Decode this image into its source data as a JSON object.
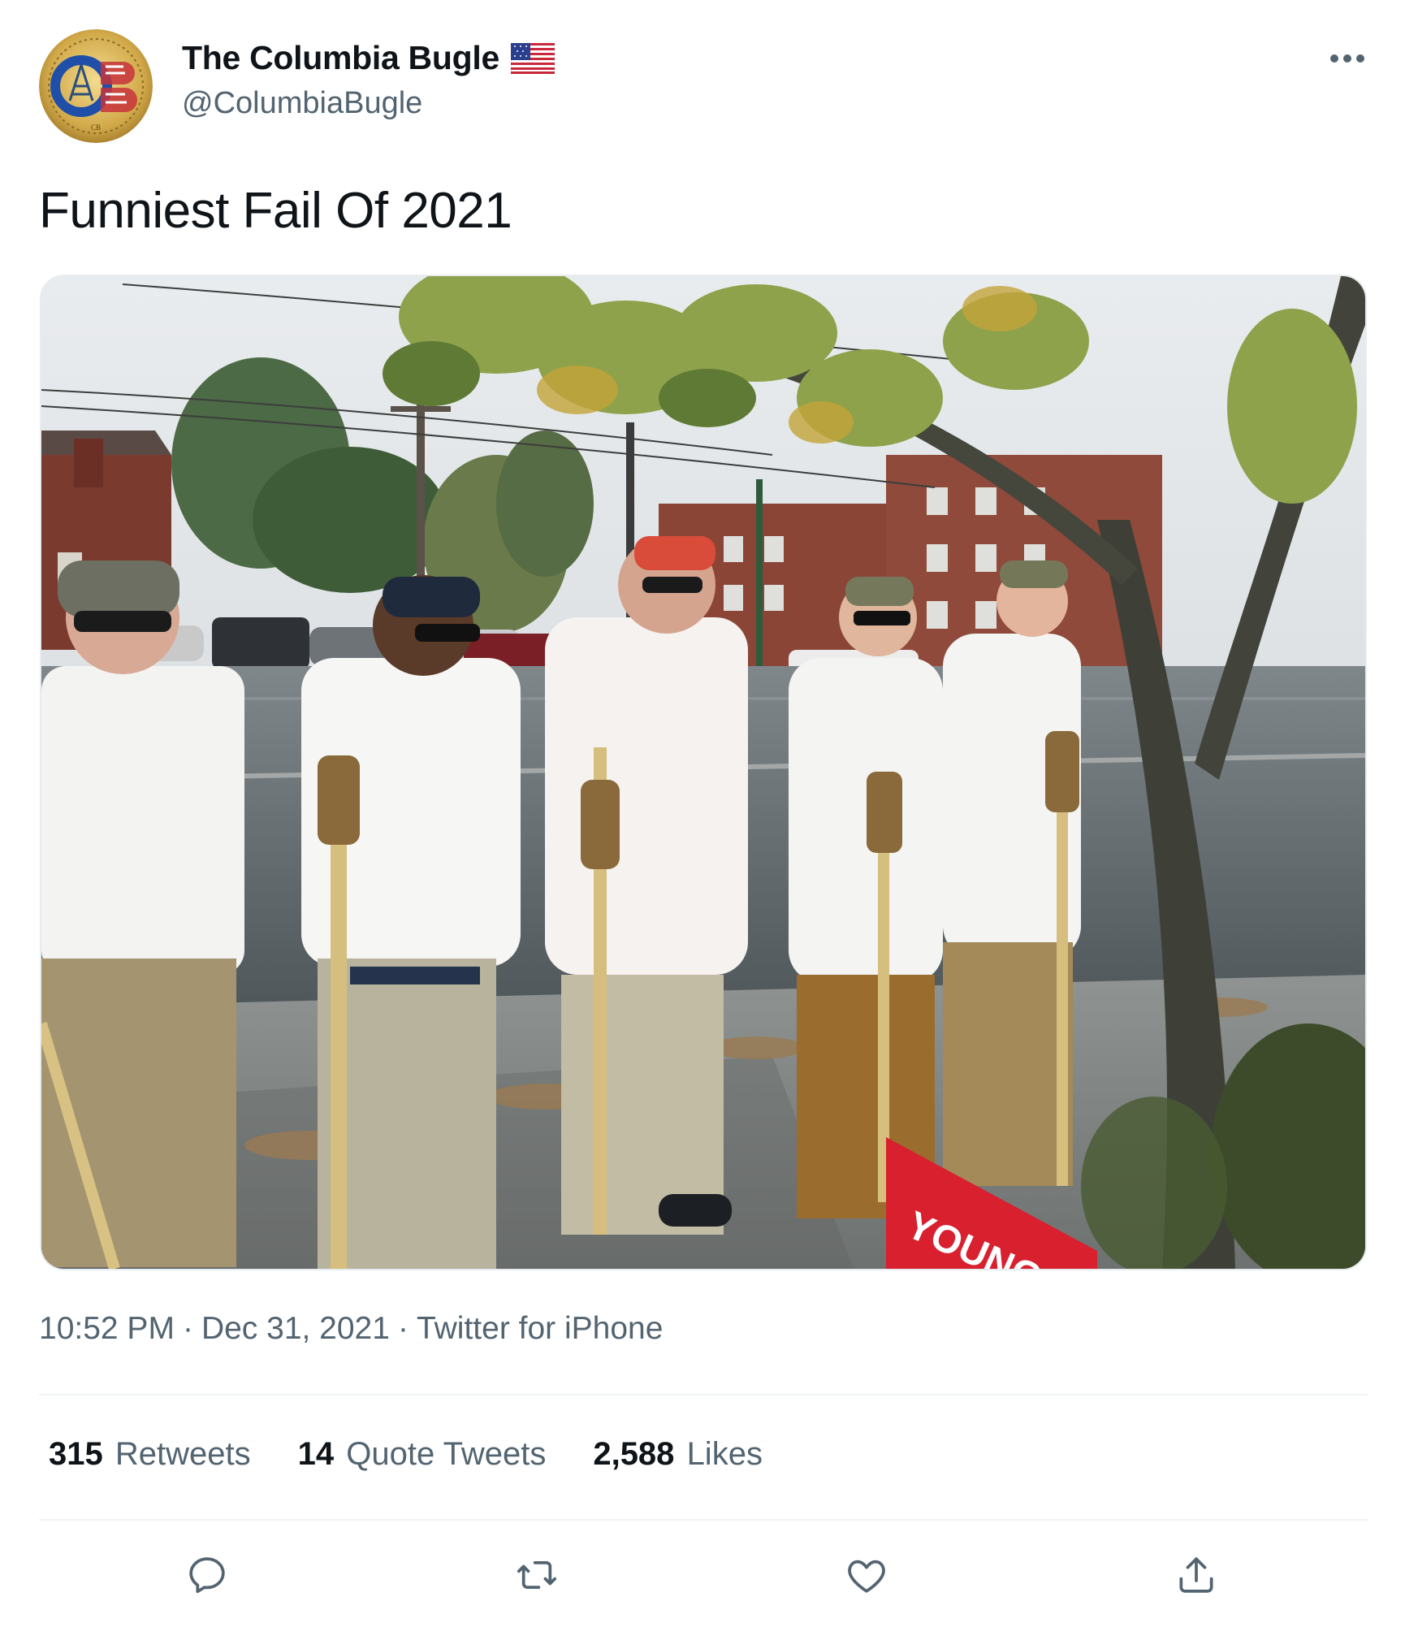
{
  "tweet": {
    "author": {
      "display_name": "The Columbia Bugle",
      "handle": "@ColumbiaBugle",
      "flag_icon": "us-flag-icon",
      "avatar_text": "CB"
    },
    "text": "Funniest Fail Of 2021",
    "media": {
      "sign_text": "YOUNG"
    },
    "meta": {
      "time": "10:52 PM",
      "date": "Dec 31, 2021",
      "source": "Twitter for iPhone",
      "separator": "·"
    },
    "stats": {
      "retweets": {
        "count": "315",
        "label": "Retweets"
      },
      "quote_tweets": {
        "count": "14",
        "label": "Quote Tweets"
      },
      "likes": {
        "count": "2,588",
        "label": "Likes"
      }
    },
    "actions": [
      "reply-icon",
      "retweet-icon",
      "like-icon",
      "share-icon"
    ]
  },
  "colors": {
    "text_primary": "#0f1419",
    "text_secondary": "#536471",
    "divider": "#eff3f4",
    "sign_red": "#d8202f"
  }
}
